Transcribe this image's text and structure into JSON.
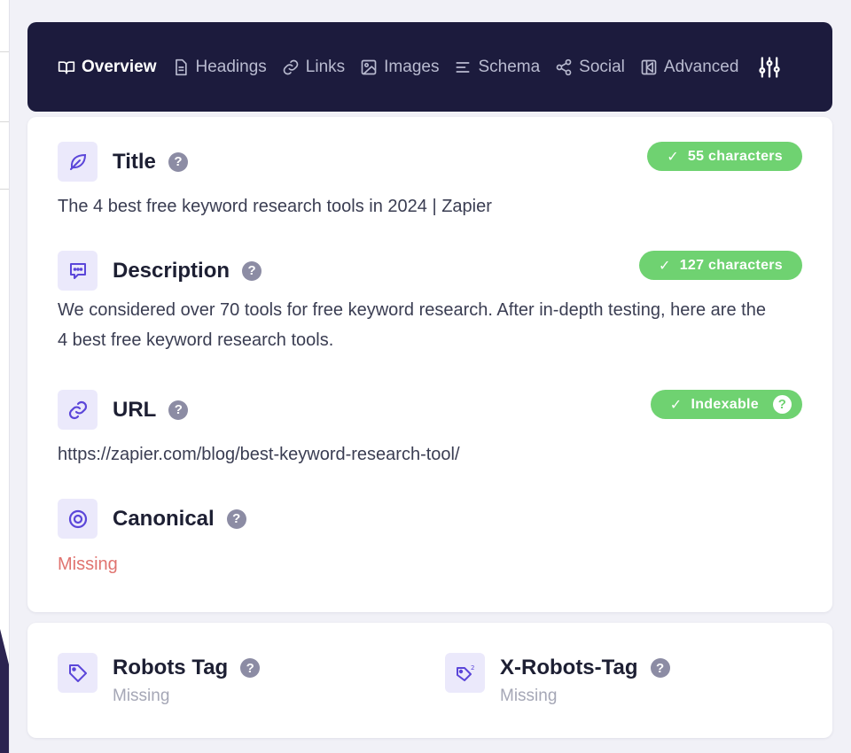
{
  "nav": {
    "items": [
      {
        "label": "Overview",
        "icon": "book-open-icon",
        "active": true
      },
      {
        "label": "Headings",
        "icon": "document-icon",
        "active": false
      },
      {
        "label": "Links",
        "icon": "link-icon",
        "active": false
      },
      {
        "label": "Images",
        "icon": "image-icon",
        "active": false
      },
      {
        "label": "Schema",
        "icon": "list-icon",
        "active": false
      },
      {
        "label": "Social",
        "icon": "share-icon",
        "active": false
      },
      {
        "label": "Advanced",
        "icon": "advanced-icon",
        "active": false
      }
    ],
    "settings_icon": "sliders-icon"
  },
  "overview": {
    "title": {
      "label": "Title",
      "badge": "55 characters",
      "value": "The 4 best free keyword research tools in 2024 | Zapier"
    },
    "description": {
      "label": "Description",
      "badge": "127 characters",
      "value": "We considered over 70 tools for free keyword research. After in-depth testing, here are the 4 best free keyword research tools."
    },
    "url": {
      "label": "URL",
      "badge": "Indexable",
      "value": "https://zapier.com/blog/best-keyword-research-tool/"
    },
    "canonical": {
      "label": "Canonical",
      "value": "Missing"
    }
  },
  "robots": {
    "robots_tag": {
      "label": "Robots Tag",
      "value": "Missing"
    },
    "x_robots_tag": {
      "label": "X-Robots-Tag",
      "value": "Missing"
    }
  },
  "help_glyph": "?",
  "check_glyph": "✓",
  "colors": {
    "nav_bg": "#1c1b3d",
    "badge_green": "#6fd271",
    "icon_tile": "#ebe9fb",
    "icon_accent": "#5b46d9",
    "missing_red": "#e0736f"
  }
}
